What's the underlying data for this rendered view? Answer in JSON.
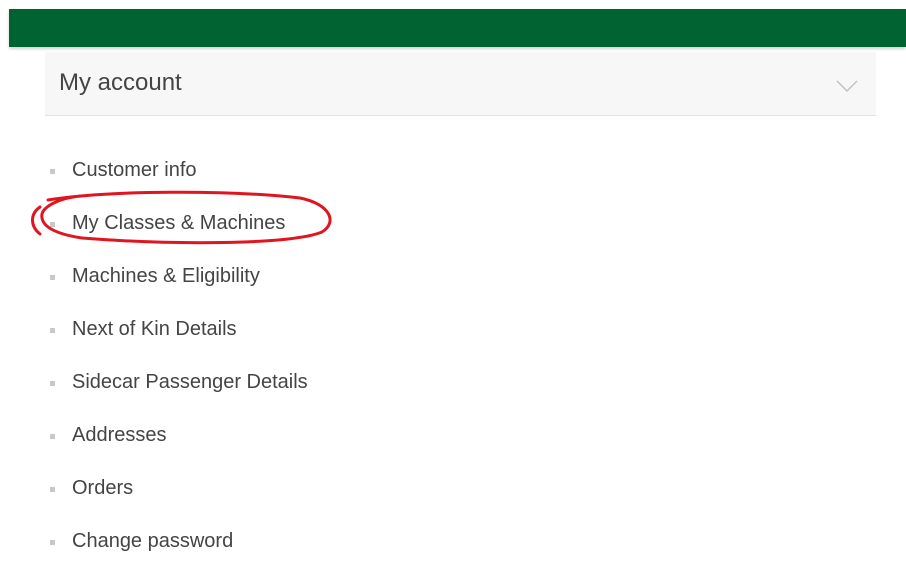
{
  "header": {
    "bar_color": "#006331"
  },
  "account_panel": {
    "title": "My account",
    "toggle_icon": "chevron-down-icon"
  },
  "menu": {
    "items": [
      {
        "label": "Customer info"
      },
      {
        "label": "My Classes & Machines",
        "annotated": true
      },
      {
        "label": "Machines & Eligibility"
      },
      {
        "label": "Next of Kin Details"
      },
      {
        "label": "Sidecar Passenger Details"
      },
      {
        "label": "Addresses"
      },
      {
        "label": "Orders"
      },
      {
        "label": "Change password"
      }
    ]
  },
  "annotation": {
    "shape": "hand-drawn circle",
    "color": "#e0151f"
  }
}
